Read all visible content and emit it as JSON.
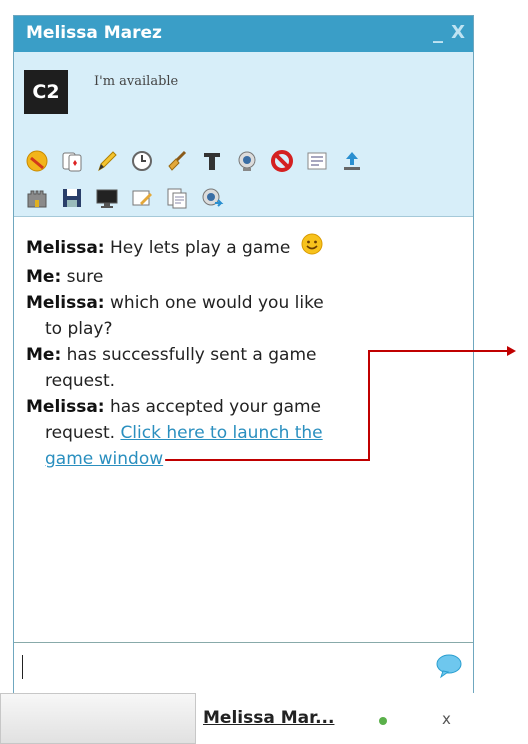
{
  "window": {
    "title": "Melissa Marez",
    "minimize_label": "_",
    "close_label": "X"
  },
  "profile": {
    "avatar_text": "C2",
    "status": "I'm available"
  },
  "toolbar": {
    "row1": [
      "emoticon-icon",
      "cards-icon",
      "pencil-icon",
      "clock-icon",
      "broom-icon",
      "font-icon",
      "webcam-icon",
      "block-icon",
      "log-icon",
      "upload-icon"
    ],
    "row2": [
      "castle-icon",
      "save-icon",
      "monitor-icon",
      "edit-icon",
      "documents-icon",
      "webcam-share-icon"
    ]
  },
  "messages": [
    {
      "who": "Melissa:",
      "text": "Hey lets play a game"
    },
    {
      "who": "Me:",
      "text": "sure"
    },
    {
      "who": "Melissa:",
      "text": "which one would you like",
      "cont": "to play?"
    },
    {
      "who": "Me:",
      "text": "has successfully sent a game",
      "cont": "request."
    },
    {
      "who": "Melissa:",
      "text": "has accepted your game",
      "cont": "request.",
      "link1": "Click here to launch the",
      "link2": "game window"
    }
  ],
  "taskbar": {
    "tab_name": "Melissa Mar...",
    "close_label": "x"
  },
  "annotation_color": "#c00000"
}
